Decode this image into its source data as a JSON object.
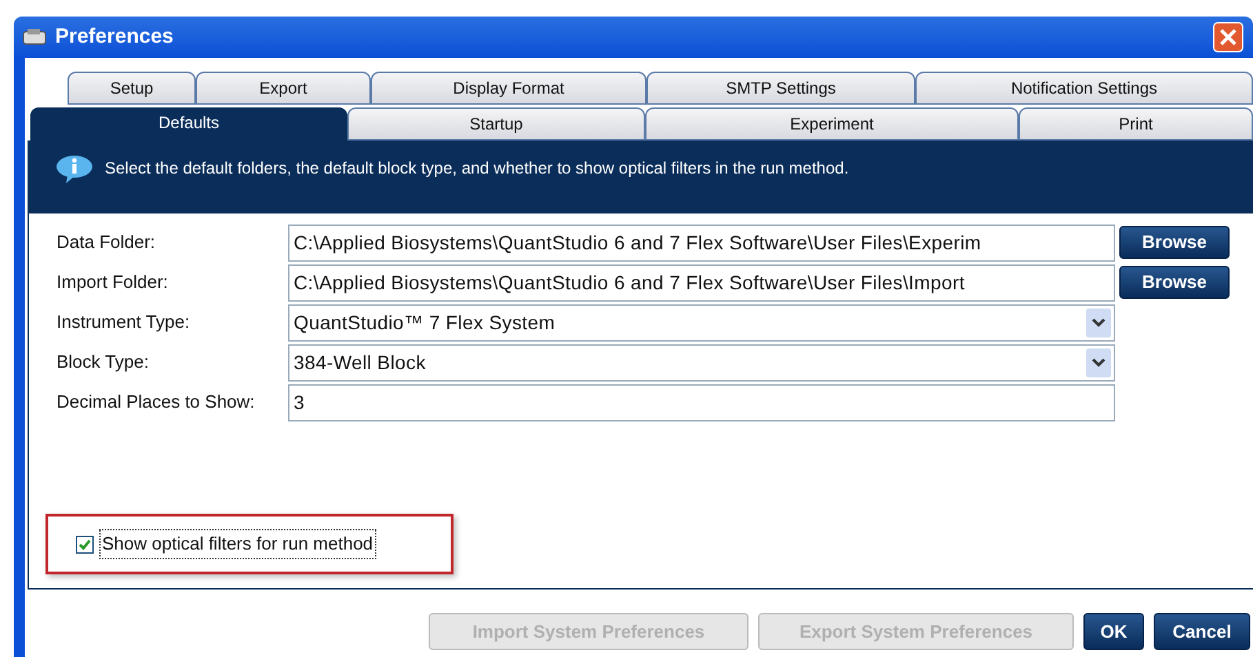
{
  "window": {
    "title": "Preferences"
  },
  "tab_rows": [
    [
      {
        "label": "Setup",
        "selected": false
      },
      {
        "label": "Export",
        "selected": false
      },
      {
        "label": "Display Format",
        "selected": false
      },
      {
        "label": "SMTP Settings",
        "selected": false
      },
      {
        "label": "Notification Settings",
        "selected": false
      }
    ],
    [
      {
        "label": "Defaults",
        "selected": true
      },
      {
        "label": "Startup",
        "selected": false
      },
      {
        "label": "Experiment",
        "selected": false
      },
      {
        "label": "Print",
        "selected": false
      }
    ]
  ],
  "info": {
    "message": "Select the default folders, the default block type, and whether to show optical filters in the run method."
  },
  "fields": [
    {
      "kind": "path",
      "label": "Data Folder:",
      "value": "C:\\Applied Biosystems\\QuantStudio 6 and 7 Flex Software\\User Files\\Experim",
      "button": "Browse"
    },
    {
      "kind": "path",
      "label": "Import Folder:",
      "value": "C:\\Applied Biosystems\\QuantStudio 6 and 7 Flex Software\\User Files\\Import",
      "button": "Browse"
    },
    {
      "kind": "dropdown",
      "label": "Instrument Type:",
      "value": "QuantStudio™ 7 Flex System"
    },
    {
      "kind": "dropdown",
      "label": "Block Type:",
      "value": "384-Well Block"
    },
    {
      "kind": "text",
      "label": "Decimal Places to Show:",
      "value": "3"
    }
  ],
  "optical_filters": {
    "label": "Show optical filters for run method",
    "checked": true,
    "highlighted": true
  },
  "buttons": [
    {
      "label": "Import System Preferences",
      "disabled": true
    },
    {
      "label": "Export System Preferences",
      "disabled": true
    },
    {
      "label": "OK",
      "disabled": false
    },
    {
      "label": "Cancel",
      "disabled": false
    }
  ]
}
